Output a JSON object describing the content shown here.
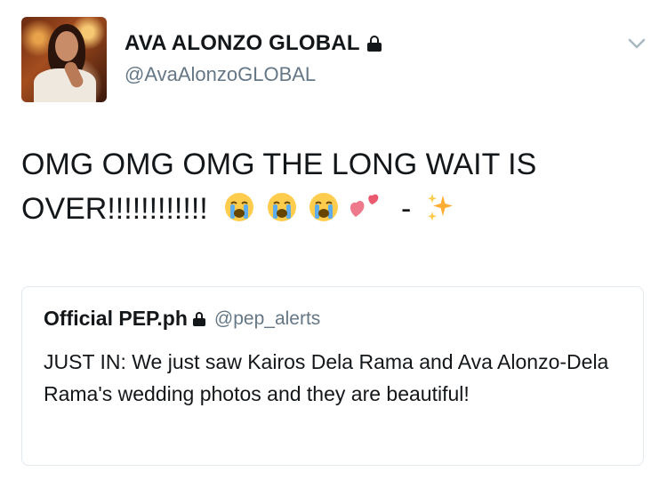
{
  "author": {
    "display_name": "AVA ALONZO GLOBAL",
    "handle": "@AvaAlonzoGLOBAL",
    "protected": true
  },
  "tweet": {
    "text_line1": "OMG OMG OMG THE LONG WAIT IS",
    "text_line2": "OVER!!!!!!!!!!!!",
    "dash": "-",
    "emojis": [
      "loudly-crying-face",
      "loudly-crying-face",
      "loudly-crying-face",
      "two-hearts",
      "sparkles"
    ]
  },
  "quoted_tweet": {
    "display_name": "Official PEP.ph",
    "handle": "@pep_alerts",
    "protected": true,
    "text": "JUST IN: We just saw Kairos Dela Rama and Ava Alonzo-Dela Rama's wedding photos and they are beautiful!"
  },
  "icons": {
    "menu": "chevron-down-icon",
    "lock": "lock-icon"
  },
  "colors": {
    "text": "#14171a",
    "secondary": "#657786",
    "border": "#e1e8ed"
  }
}
